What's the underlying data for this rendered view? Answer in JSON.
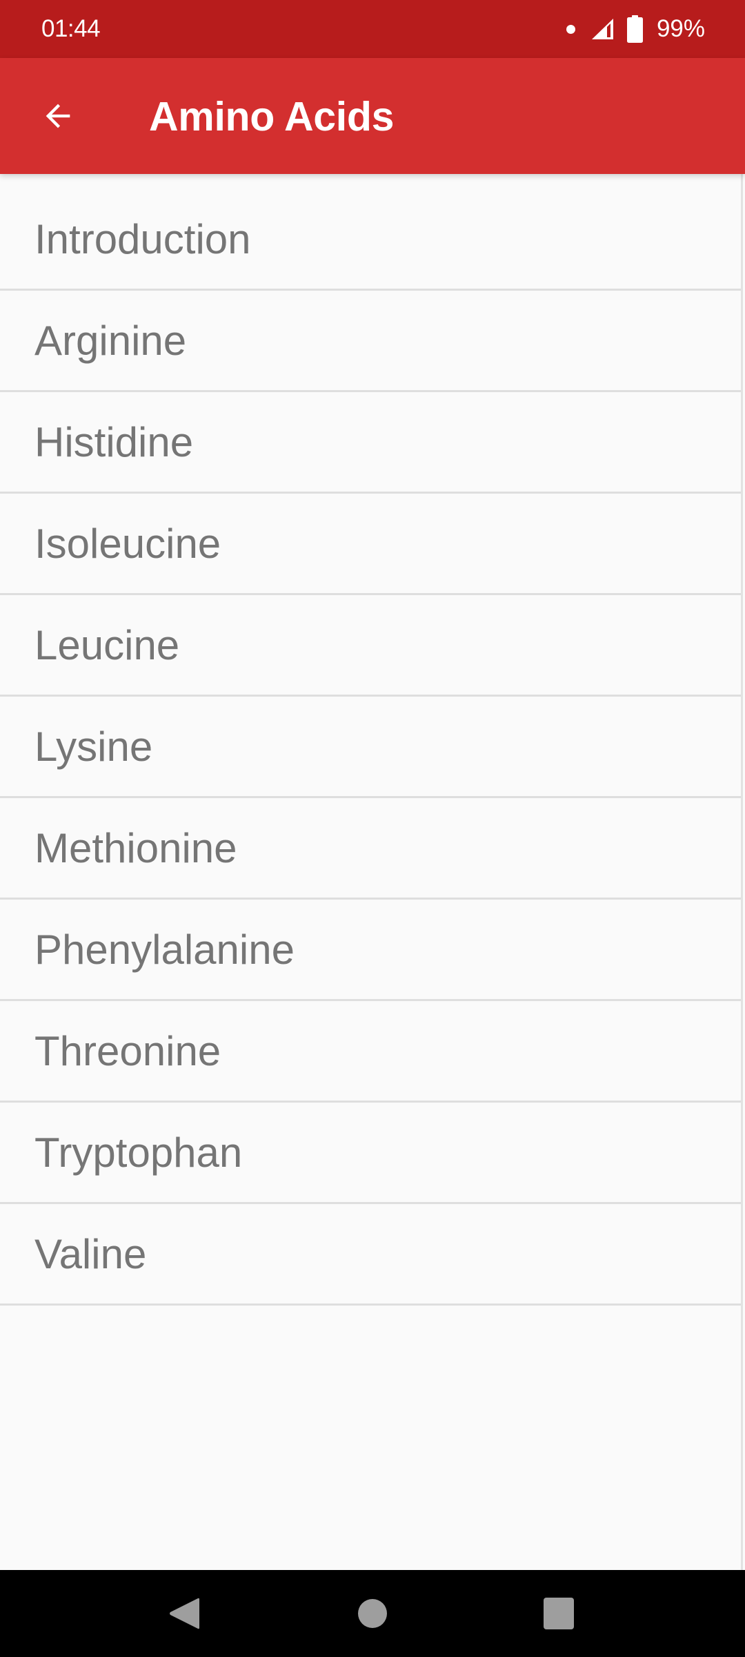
{
  "status_bar": {
    "time": "01:44",
    "battery_percent": "99%",
    "battery_level": 0.99,
    "icons": [
      "notification-dot-icon",
      "cell-signal-icon",
      "battery-icon"
    ],
    "background_color": "#B71C1C"
  },
  "app_bar": {
    "title": "Amino Acids",
    "back_icon": "arrow-left-icon",
    "background_color": "#D32F2F",
    "text_color": "#FFFFFF"
  },
  "list": {
    "text_color": "#757575",
    "divider_color": "#DEDEDE",
    "items": [
      {
        "label": "Introduction"
      },
      {
        "label": "Arginine"
      },
      {
        "label": "Histidine"
      },
      {
        "label": "Isoleucine"
      },
      {
        "label": "Leucine"
      },
      {
        "label": "Lysine"
      },
      {
        "label": "Methionine"
      },
      {
        "label": "Phenylalanine"
      },
      {
        "label": "Threonine"
      },
      {
        "label": "Tryptophan"
      },
      {
        "label": "Valine"
      }
    ]
  },
  "nav_bar": {
    "buttons": [
      {
        "name": "back",
        "icon": "triangle-back-icon"
      },
      {
        "name": "home",
        "icon": "circle-home-icon"
      },
      {
        "name": "recents",
        "icon": "square-recents-icon"
      }
    ]
  }
}
